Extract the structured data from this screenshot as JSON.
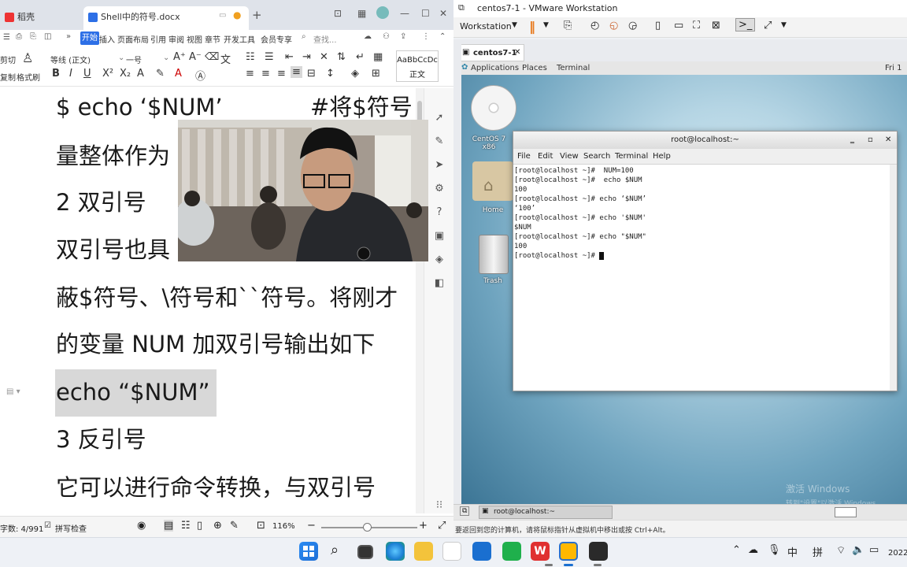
{
  "wps": {
    "tabs": [
      {
        "label": "稻壳"
      },
      {
        "label": "Shell中的符号.docx"
      }
    ],
    "new_tab": "+",
    "menu": [
      "开始",
      "插入",
      "页面布局",
      "引用",
      "审阅",
      "视图",
      "章节",
      "开发工具",
      "会员专享"
    ],
    "search_placeholder": "查找...",
    "toolbar": {
      "cut": "剪切",
      "format_painter": "格式刷",
      "copy": "复制",
      "font_name": "等线 (正文)",
      "font_size": "一号",
      "style_sample": "AaBbCcDc",
      "style_name": "正文"
    },
    "doc_lines": [
      "$ echo ‘$NUM’",
      "#将$符号",
      "量整体作为",
      "2 双引号",
      "双引号也具",
      "蔽$符号、\\符号和``符号。将刚才",
      "的变量 NUM 加双引号输出如下",
      "echo “$NUM”",
      "3 反引号",
      "它可以进行命令转换，与双引号"
    ],
    "status": {
      "word_count": "字数: 4/991",
      "spellcheck": "拼写检查",
      "zoom": "116%"
    }
  },
  "vmware": {
    "title": "centos7-1 - VMware Workstation",
    "workstation_menu": "Workstation",
    "vm_tab": "centos7-1",
    "gnome_bar": {
      "applications": "Applications",
      "places": "Places",
      "terminal": "Terminal",
      "clock": "Fri 1"
    },
    "desktop_icons": [
      {
        "label": "CentOS 7 x86"
      },
      {
        "label": "Home"
      },
      {
        "label": "Trash"
      }
    ],
    "terminal": {
      "title": "root@localhost:~",
      "menu": [
        "File",
        "Edit",
        "View",
        "Search",
        "Terminal",
        "Help"
      ],
      "lines": [
        "[root@localhost ~]#  NUM=100",
        "[root@localhost ~]#  echo $NUM",
        "100",
        "[root@localhost ~]# echo ‘$NUM’",
        "‘100’",
        "[root@localhost ~]# echo '$NUM'",
        "$NUM",
        "[root@localhost ~]# echo \"$NUM\"",
        "100",
        "[root@localhost ~]# "
      ]
    },
    "guest_taskbar": {
      "window": "root@localhost:~"
    },
    "watermark": [
      "激活 Windows",
      "转到\"设置\"以激活 Windows。"
    ],
    "status": "要返回到您的计算机，请将鼠标指针从虚拟机中移出或按 Ctrl+Alt。"
  },
  "windows_taskbar": {
    "ime1": "中",
    "ime2": "拼",
    "clock": "2022"
  }
}
